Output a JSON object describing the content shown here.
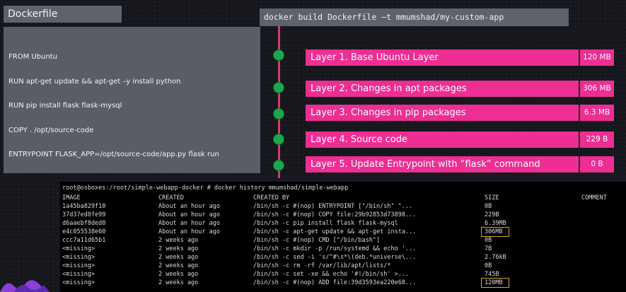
{
  "dockerfile": {
    "title": "Dockerfile",
    "lines": [
      "FROM Ubuntu",
      "RUN apt-get update && apt-get –y install python",
      "RUN pip install flask flask-mysql",
      "COPY . /opt/source-code",
      "ENTRYPOINT FLASK_APP=/opt/source-code/app.py flask run"
    ]
  },
  "build_command": "docker build Dockerfile –t mmumshad/my-custom-app",
  "layers": [
    {
      "label": "Layer 1. Base Ubuntu Layer",
      "size": "120 MB"
    },
    {
      "label": "Layer 2. Changes in apt packages",
      "size": "306 MB"
    },
    {
      "label": "Layer 3. Changes in pip packages",
      "size": "6.3 MB"
    },
    {
      "label": "Layer 4. Source code",
      "size": "229 B"
    },
    {
      "label": "Layer 5. Update Entrypoint with “flask” command",
      "size": "0 B"
    }
  ],
  "terminal": {
    "prompt": "root@osboxes:/root/simple-webapp-docker # docker history mmumshad/simple-webapp",
    "headers": [
      "IMAGE",
      "CREATED",
      "CREATED BY",
      "SIZE",
      "COMMENT"
    ],
    "rows": [
      [
        "1a45ba829f10",
        "About an hour ago",
        "/bin/sh -c #(nop)  ENTRYPOINT [\"/bin/sh\" \"...",
        "0B",
        ""
      ],
      [
        "37d37ed8fe99",
        "About an hour ago",
        "/bin/sh -c #(nop) COPY file:29b92853d73898...",
        "229B",
        ""
      ],
      [
        "d6aaebf8ded0",
        "About an hour ago",
        "/bin/sh -c pip install flask flask-mysql",
        "6.39MB",
        ""
      ],
      [
        "e4c055538e60",
        "About an hour ago",
        "/bin/sh -c apt-get update && apt-get insta...",
        "306MB",
        ""
      ],
      [
        "ccc7a11d65b1",
        "2 weeks ago",
        "/bin/sh -c #(nop)  CMD [\"/bin/bash\"]",
        "0B",
        ""
      ],
      [
        "<missing>",
        "2 weeks ago",
        "/bin/sh -c mkdir -p /run/systemd && echo '...",
        "7B",
        ""
      ],
      [
        "<missing>",
        "2 weeks ago",
        "/bin/sh -c sed -i 's/^#\\s*\\(deb.*universe\\...",
        "2.76kB",
        ""
      ],
      [
        "<missing>",
        "2 weeks ago",
        "/bin/sh -c rm -rf /var/lib/apt/lists/*",
        "0B",
        ""
      ],
      [
        "<missing>",
        "2 weeks ago",
        "/bin/sh -c set -xe   && echo '#!/bin/sh' >...",
        "745B",
        ""
      ],
      [
        "<missing>",
        "2 weeks ago",
        "/bin/sh -c #(nop) ADD file:39d3593ea220e68...",
        "120MB",
        ""
      ]
    ]
  },
  "colors": {
    "layer_bar": "#ee2e93",
    "timeline": "#d23b70",
    "node": "#1ba84e",
    "highlight": "#e0a22c"
  }
}
